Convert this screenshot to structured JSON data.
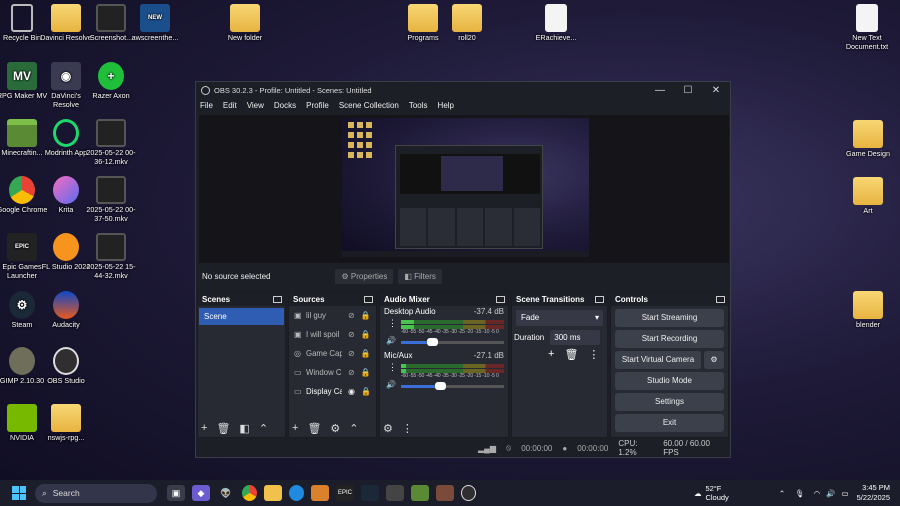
{
  "desktop": {
    "icons": [
      {
        "label": "Recycle Bin",
        "kind": "recycle"
      },
      {
        "label": "Davinci Resolve",
        "kind": "folder"
      },
      {
        "label": "Screenshot...",
        "kind": "screenshot"
      },
      {
        "label": "awscreenthe...",
        "kind": "themes"
      },
      {
        "label": "New folder",
        "kind": "folder"
      },
      {
        "label": "Programs",
        "kind": "folder"
      },
      {
        "label": "roll20",
        "kind": "folder"
      },
      {
        "label": "ERachieve...",
        "kind": "doc"
      },
      {
        "label": "New Text Document.txt",
        "kind": "doc"
      },
      {
        "label": "RPG Maker MV",
        "kind": "app"
      },
      {
        "label": "DaVinci's Resolve",
        "kind": "app"
      },
      {
        "label": "Razer Axon",
        "kind": "app"
      },
      {
        "label": "Minecraftin...",
        "kind": "app"
      },
      {
        "label": "Modrinth App",
        "kind": "app"
      },
      {
        "label": "2025-05-22 00-36-12.mkv",
        "kind": "video"
      },
      {
        "label": "Google Chrome",
        "kind": "app"
      },
      {
        "label": "Krita",
        "kind": "app"
      },
      {
        "label": "2025-05-22 00-37-50.mkv",
        "kind": "video"
      },
      {
        "label": "Epic Games Launcher",
        "kind": "app"
      },
      {
        "label": "FL Studio 2024",
        "kind": "app"
      },
      {
        "label": "2025-05-22 15-44-32.mkv",
        "kind": "video"
      },
      {
        "label": "Steam",
        "kind": "app"
      },
      {
        "label": "Audacity",
        "kind": "app"
      },
      {
        "label": "GIMP 2.10.30",
        "kind": "app"
      },
      {
        "label": "OBS Studio",
        "kind": "app"
      },
      {
        "label": "NVIDIA",
        "kind": "app"
      },
      {
        "label": "nswjs-rpg...",
        "kind": "folder"
      },
      {
        "label": "Game Design",
        "kind": "folder"
      },
      {
        "label": "Art",
        "kind": "folder"
      },
      {
        "label": "blender",
        "kind": "folder"
      }
    ]
  },
  "obs": {
    "title": "OBS 30.2.3 - Profile: Untitled - Scenes: Untitled",
    "menu": [
      "File",
      "Edit",
      "View",
      "Docks",
      "Profile",
      "Scene Collection",
      "Tools",
      "Help"
    ],
    "no_source": "No source selected",
    "properties": "Properties",
    "filters": "Filters",
    "scenes": {
      "header": "Scenes",
      "items": [
        "Scene"
      ]
    },
    "sources": {
      "header": "Sources",
      "items": [
        {
          "name": "lil guy",
          "icon": "image-icon",
          "active": false
        },
        {
          "name": "I will spoil",
          "icon": "image-icon",
          "active": false
        },
        {
          "name": "Game Cap",
          "icon": "gamepad-icon",
          "active": false
        },
        {
          "name": "Window C",
          "icon": "window-icon",
          "active": false
        },
        {
          "name": "Display Ca",
          "icon": "monitor-icon",
          "active": true
        }
      ]
    },
    "mixer": {
      "header": "Audio Mixer",
      "scale": "-60 -55 -50 -45 -40 -35 -30 -25 -20 -15 -10 -5 0",
      "channels": [
        {
          "name": "Desktop Audio",
          "db": "-37.4 dB",
          "level": 0.13,
          "volume": 0.3
        },
        {
          "name": "Mic/Aux",
          "db": "-27.1 dB",
          "level": 0.05,
          "volume": 0.38
        }
      ]
    },
    "transitions": {
      "header": "Scene Transitions",
      "type": "Fade",
      "duration_label": "Duration",
      "duration": "300 ms"
    },
    "controls": {
      "header": "Controls",
      "start_streaming": "Start Streaming",
      "start_recording": "Start Recording",
      "start_virtual_camera": "Start Virtual Camera",
      "studio_mode": "Studio Mode",
      "settings": "Settings",
      "exit": "Exit"
    },
    "status": {
      "stream_time": "00:00:00",
      "rec_time": "00:00:00",
      "cpu": "CPU: 1.2%",
      "fps": "60.00 / 60.00 FPS"
    }
  },
  "taskbar": {
    "search": "Search",
    "weather_temp": "52°F",
    "weather_desc": "Cloudy",
    "time": "3:45 PM",
    "date": "5/22/2025"
  }
}
